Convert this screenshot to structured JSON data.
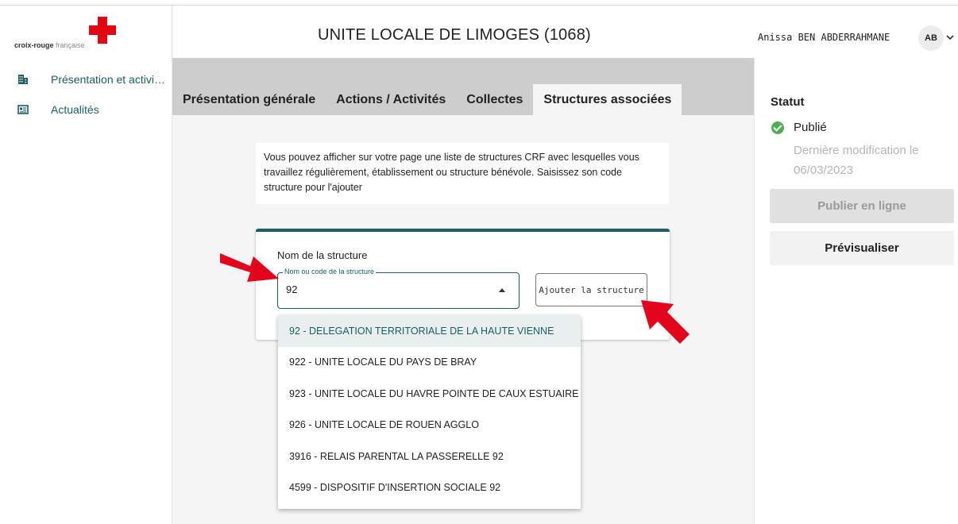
{
  "header": {
    "logo_brand": "croix-rouge",
    "logo_suffix": "française",
    "title": "UNITE LOCALE DE LIMOGES (1068)",
    "user_name": "Anissa BEN ABDERRAHMANE",
    "avatar_initials": "AB"
  },
  "sidebar": {
    "items": [
      {
        "label": "Présentation et activités",
        "icon": "building-icon"
      },
      {
        "label": "Actualités",
        "icon": "newspaper-icon"
      }
    ]
  },
  "tabs": [
    {
      "label": "Présentation générale",
      "active": false
    },
    {
      "label": "Actions / Activités",
      "active": false
    },
    {
      "label": "Collectes",
      "active": false
    },
    {
      "label": "Structures associées",
      "active": true
    }
  ],
  "info_text": "Vous pouvez afficher sur votre page une liste de structures CRF avec lesquelles vous travaillez régulièrement, établissement ou structure bénévole. Saisissez son code structure pour l'ajouter",
  "form": {
    "card_title": "Nom de la structure",
    "field_label": "Nom ou code de la structure",
    "field_value": "92",
    "add_button": "Ajouter la structure"
  },
  "dropdown": {
    "options": [
      "92 - DELEGATION TERRITORIALE DE LA HAUTE VIENNE",
      "922 - UNITE LOCALE DU PAYS DE BRAY",
      "923 - UNITE LOCALE DU HAVRE POINTE DE CAUX ESTUAIRE",
      "926 - UNITE LOCALE DE ROUEN AGGLO",
      "3916 - RELAIS PARENTAL LA PASSERELLE 92",
      "4599 - DISPOSITIF D'INSERTION SOCIALE 92"
    ],
    "highlighted_index": 0
  },
  "status": {
    "title": "Statut",
    "value": "Publié",
    "last_modified": "Dernière modification le 06/03/2023",
    "publish_button": "Publier en ligne",
    "preview_button": "Prévisualiser"
  },
  "colors": {
    "brand_red": "#e30613",
    "accent_teal": "#1b5e63",
    "success_green": "#4caf50",
    "arrow_red": "#e3051b"
  }
}
